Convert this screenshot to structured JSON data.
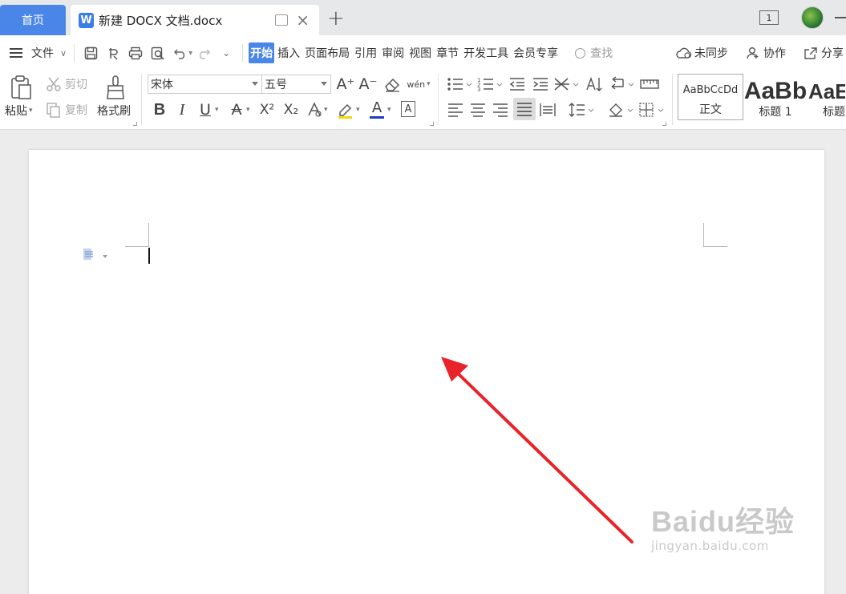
{
  "tabbar": {
    "home_tab": "首页",
    "doc_tab_icon": "W",
    "doc_tab_title": "新建 DOCX 文档.docx",
    "window_count": "1"
  },
  "menubar": {
    "file": "文件",
    "tabs": [
      "开始",
      "插入",
      "页面布局",
      "引用",
      "审阅",
      "视图",
      "章节",
      "开发工具",
      "会员专享"
    ],
    "search": "查找",
    "sync": "未同步",
    "collab": "协作",
    "share": "分享"
  },
  "ribbon": {
    "paste": "粘贴",
    "cut": "剪切",
    "copy": "复制",
    "format_painter": "格式刷",
    "font_name": "宋体",
    "font_size": "五号",
    "bold": "B",
    "italic": "I",
    "underline": "U",
    "strike": "A",
    "superscript": "X²",
    "subscript": "X₂",
    "font_color": "A",
    "char_border": "A",
    "phonetic": "wén",
    "grow_font": "A⁺",
    "shrink_font": "A⁻",
    "styles": [
      {
        "preview": "AaBbCcDd",
        "name": "正文"
      },
      {
        "preview": "AaBb",
        "name": "标题 1"
      },
      {
        "preview": "AaE",
        "name": "标题"
      }
    ]
  },
  "watermark": {
    "logo": "Baidu经验",
    "url": "jingyan.baidu.com"
  },
  "colors": {
    "accent": "#4a86e8",
    "arrow": "#e8232a",
    "font_color_bar": "#1a3cc7",
    "highlight_bar": "#f5d90a"
  }
}
